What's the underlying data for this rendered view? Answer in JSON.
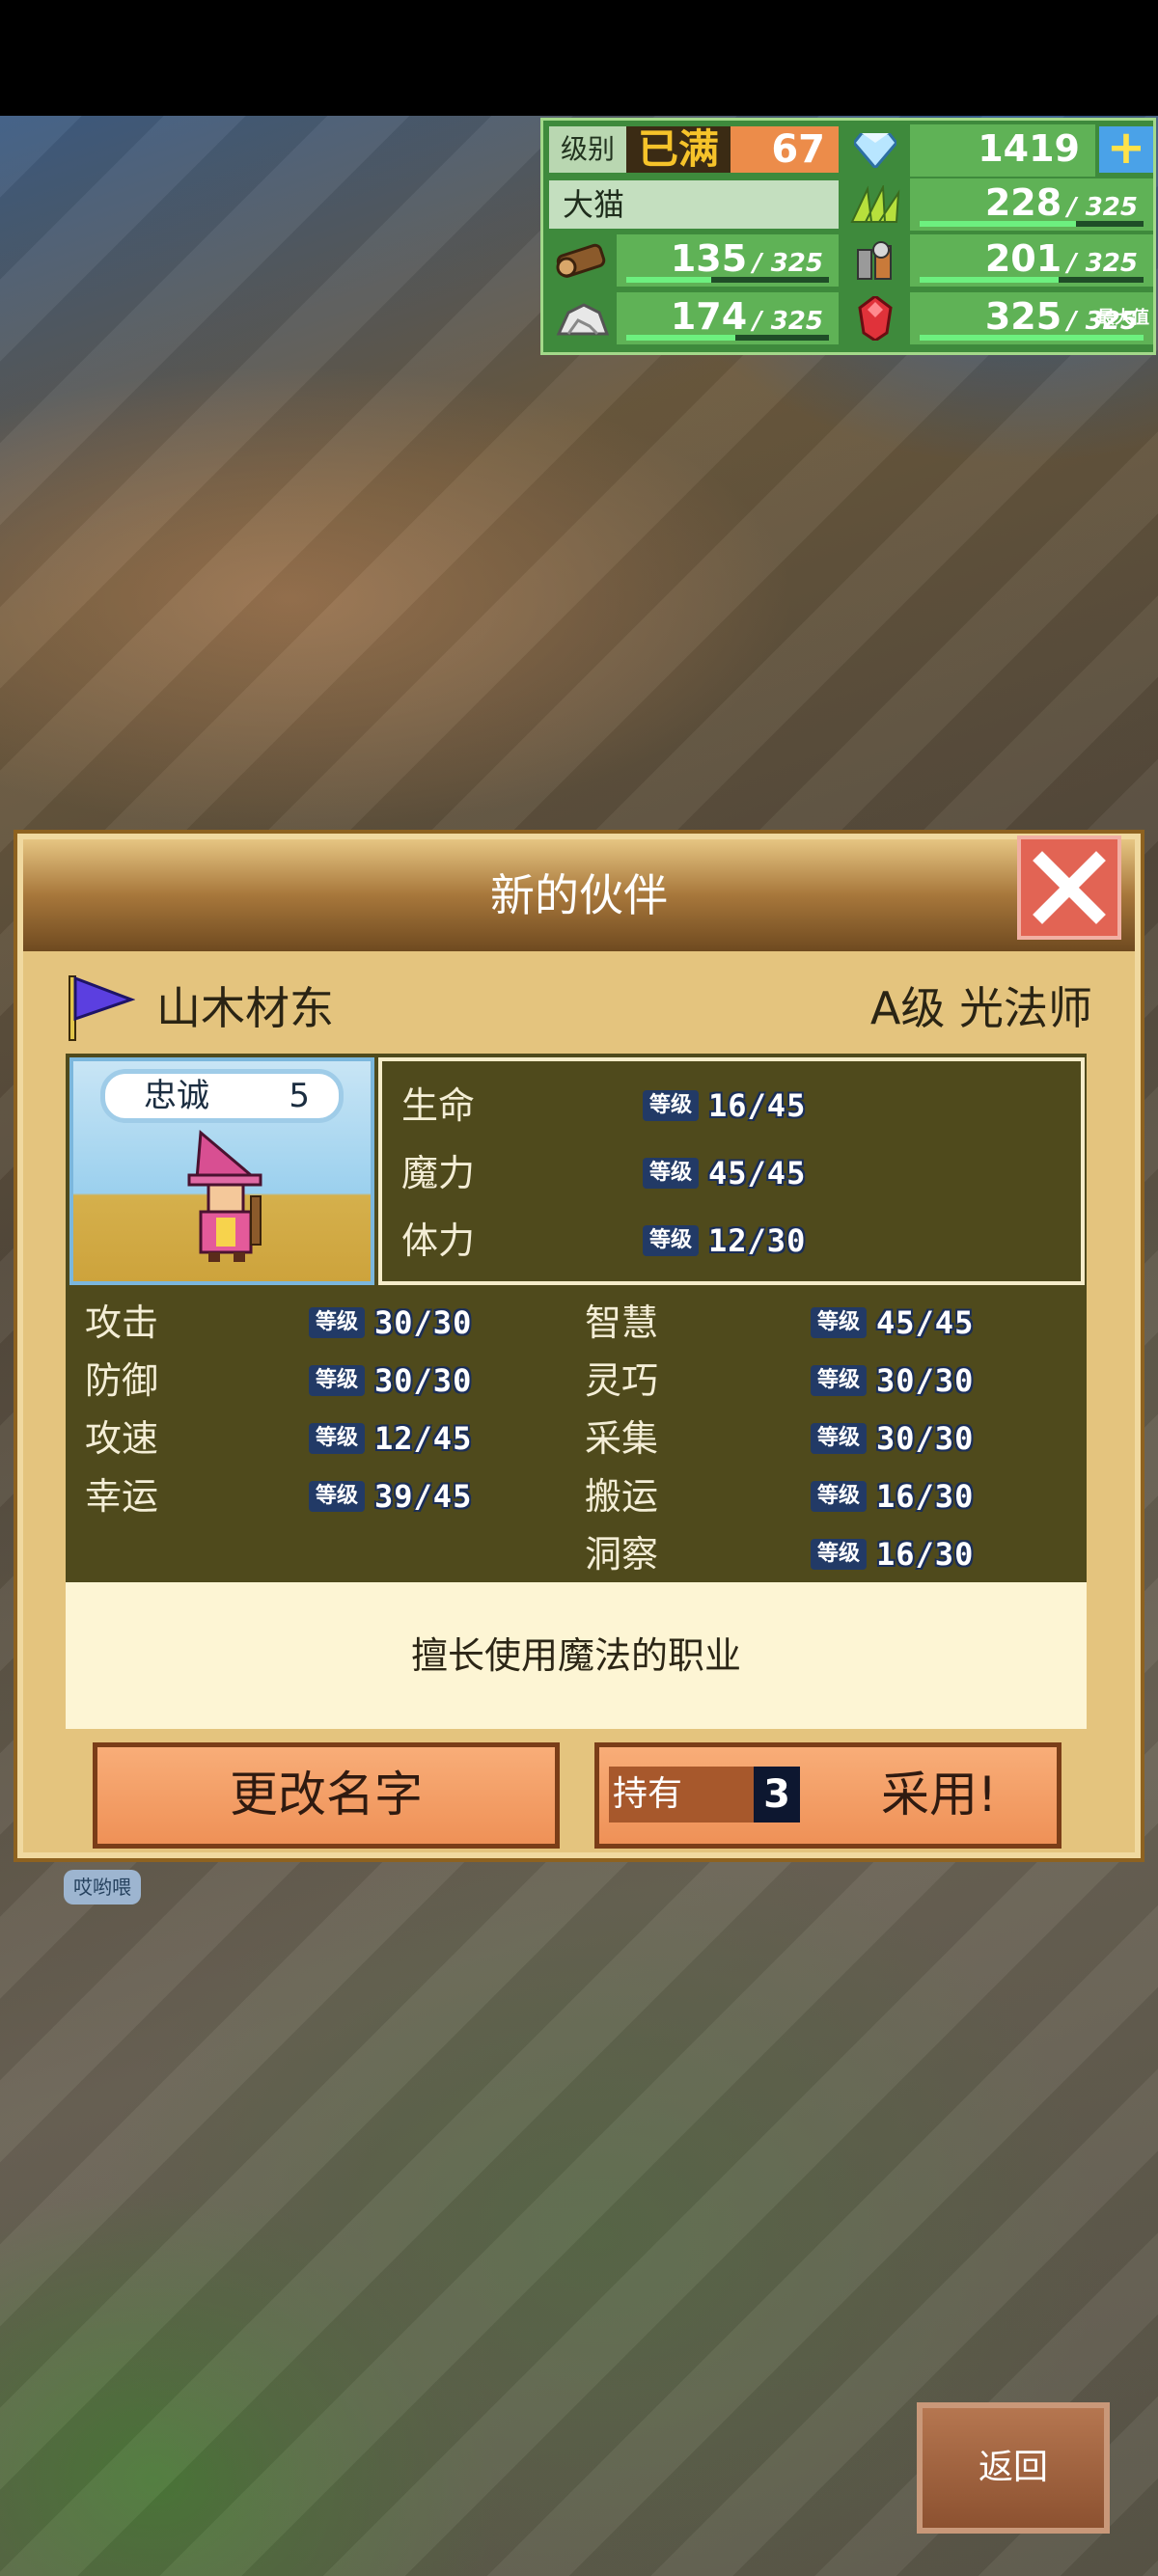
{
  "resources": {
    "level_label": "级别",
    "level_status": "已满",
    "level_value": "67",
    "gems": "1419",
    "plus_label": "+",
    "town_name": "大猫",
    "grass": "228",
    "grass_max": "/ 325",
    "wood": "135",
    "wood_max": "/ 325",
    "food": "201",
    "food_max": "/ 325",
    "ore": "174",
    "ore_max": "/ 325",
    "ruby": "325",
    "ruby_max": "/ 325",
    "max_tag": "最大值",
    "fills": {
      "grass": 0.7,
      "wood": 0.42,
      "food": 0.62,
      "ore": 0.54,
      "ruby": 1.0
    },
    "icons": [
      "diamond-icon",
      "grass-icon",
      "wood-log-icon",
      "food-icon",
      "ore-rock-icon",
      "ruby-icon"
    ]
  },
  "dialog": {
    "title": "新的伙伴",
    "close_icon": "close-icon",
    "unit_name": "山木材东",
    "unit_class": "A级 光法师",
    "loyalty_label": "忠诚",
    "loyalty_value": "5",
    "level_tag": "等级",
    "main_stats": [
      {
        "label": "生命",
        "value": "16/45"
      },
      {
        "label": "魔力",
        "value": "45/45"
      },
      {
        "label": "体力",
        "value": "12/30"
      }
    ],
    "left_stats": [
      {
        "label": "攻击",
        "value": "30/30"
      },
      {
        "label": "防御",
        "value": "30/30"
      },
      {
        "label": "攻速",
        "value": "12/45"
      },
      {
        "label": "幸运",
        "value": "39/45"
      }
    ],
    "right_stats": [
      {
        "label": "智慧",
        "value": "45/45"
      },
      {
        "label": "灵巧",
        "value": "30/30"
      },
      {
        "label": "采集",
        "value": "30/30"
      },
      {
        "label": "搬运",
        "value": "16/30"
      },
      {
        "label": "洞察",
        "value": "16/30"
      }
    ],
    "description": "擅长使用魔法的职业",
    "rename_button": "更改名字",
    "own_label": "持有",
    "own_value": "3",
    "adopt_button": "采用!"
  },
  "chat_tag": "哎哟喂",
  "back_button": "返回",
  "colors": {
    "accent_orange": "#ef9157",
    "panel_green": "#3e8a3c",
    "dialog_tan": "#e4c47e"
  }
}
